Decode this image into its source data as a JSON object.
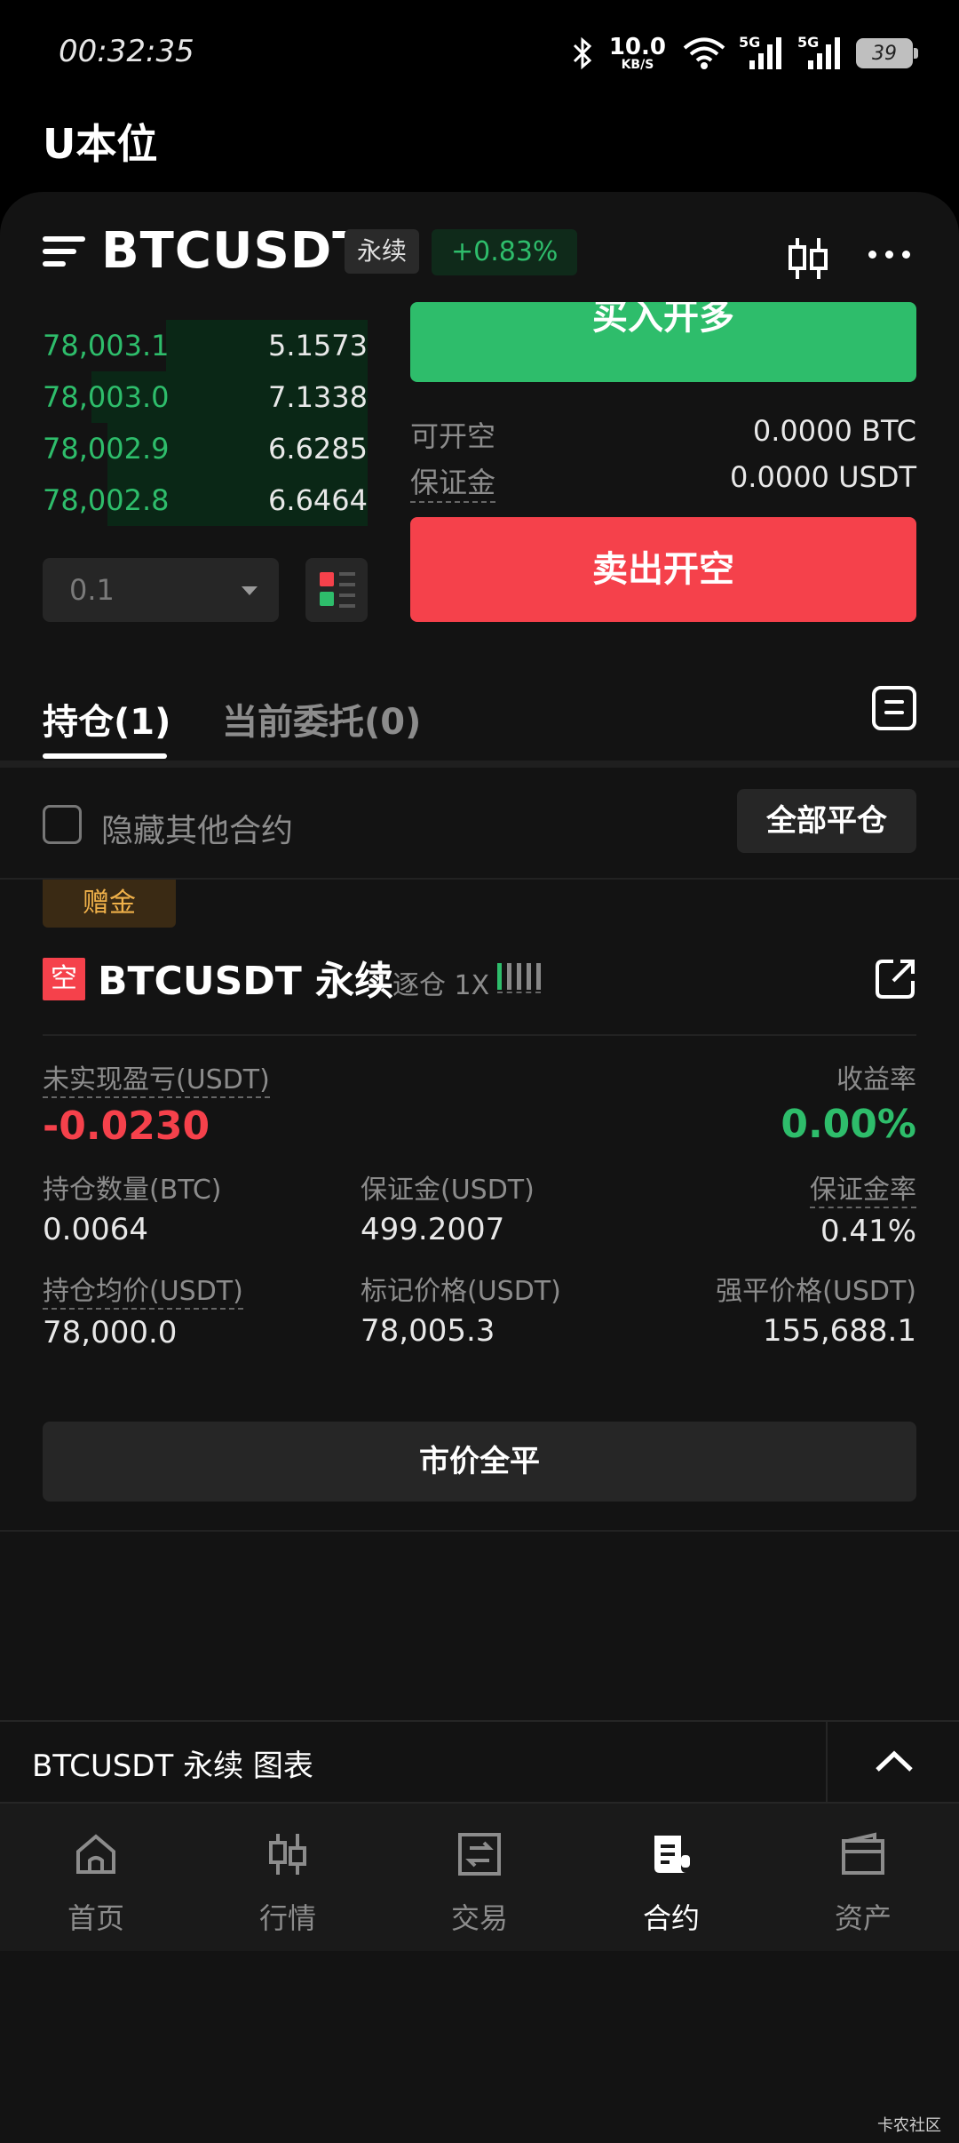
{
  "status_bar": {
    "time": "00:32:35",
    "net_speed": "10.0",
    "net_unit": "KB/S",
    "sig1": "5G",
    "sig2": "5G",
    "battery": "39"
  },
  "page_title": "U本位",
  "symbol_bar": {
    "symbol": "BTCUSDT",
    "contract_type": "永续",
    "change": "+0.83%"
  },
  "order_book": {
    "rows": [
      {
        "price": "78,003.1",
        "qty": "5.1573",
        "depth_pct": 0.62
      },
      {
        "price": "78,003.0",
        "qty": "7.1338",
        "depth_pct": 0.85
      },
      {
        "price": "78,002.9",
        "qty": "6.6285",
        "depth_pct": 0.8
      },
      {
        "price": "78,002.8",
        "qty": "6.6464",
        "depth_pct": 0.8
      }
    ],
    "precision": "0.1"
  },
  "trade_panel": {
    "buy_label": "买入开多",
    "open_short_label": "可开空",
    "open_short_value": "0.0000 BTC",
    "margin_label": "保证金",
    "margin_value": "0.0000 USDT",
    "sell_label": "卖出开空"
  },
  "tabs": {
    "positions": "持仓(1)",
    "orders": "当前委托(0)"
  },
  "filter": {
    "hide_label": "隐藏其他合约",
    "close_all": "全部平仓"
  },
  "position": {
    "bonus_tag": "赠金",
    "side": "空",
    "title": "BTCUSDT 永续",
    "mode": "逐仓 1X",
    "unrealized_pnl_label": "未实现盈亏(USDT)",
    "unrealized_pnl": "-0.0230",
    "roe_label": "收益率",
    "roe": "0.00%",
    "size_label": "持仓数量(BTC)",
    "size": "0.0064",
    "margin_label": "保证金(USDT)",
    "margin": "499.2007",
    "margin_ratio_label": "保证金率",
    "margin_ratio": "0.41%",
    "entry_label": "持仓均价(USDT)",
    "entry": "78,000.0",
    "mark_label": "标记价格(USDT)",
    "mark": "78,005.3",
    "liq_label": "强平价格(USDT)",
    "liq": "155,688.1",
    "market_close": "市价全平"
  },
  "chart_bar": {
    "label": "BTCUSDT 永续 图表"
  },
  "bottom_nav": [
    {
      "label": "首页",
      "icon": "home-icon"
    },
    {
      "label": "行情",
      "icon": "market-icon"
    },
    {
      "label": "交易",
      "icon": "trade-icon"
    },
    {
      "label": "合约",
      "icon": "contract-icon"
    },
    {
      "label": "资产",
      "icon": "wallet-icon"
    }
  ],
  "watermark": "卡农社区",
  "colors": {
    "green": "#2ebd6b",
    "red": "#f5414b",
    "bg": "#131313",
    "bonus": "#f0b14a"
  }
}
